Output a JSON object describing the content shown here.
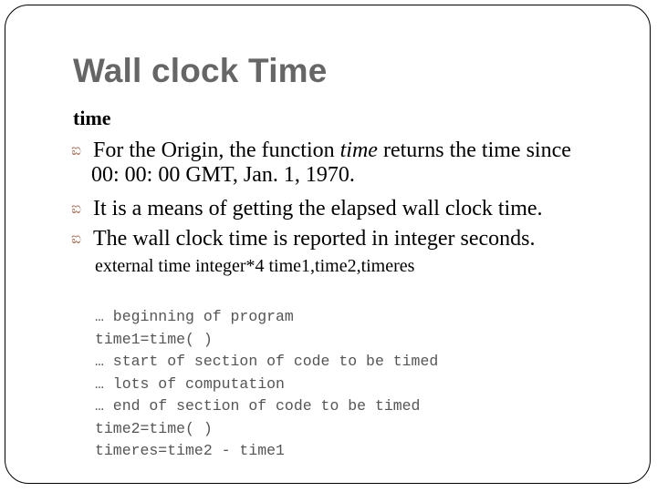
{
  "slide": {
    "title": "Wall clock Time",
    "subheading": "time",
    "bullet_icon": "curl-bullet-icon",
    "bullet_color": "#a5694e",
    "title_color": "#666666",
    "bullets": [
      {
        "before": "For the Origin, the function ",
        "emphasis": "time",
        "after": " returns the time since",
        "continuation": "00: 00: 00 GMT, Jan. 1, 1970."
      },
      {
        "text": "It is a means of getting the elapsed wall clock time."
      },
      {
        "text": "The wall clock time is reported in integer seconds."
      }
    ],
    "declaration": "external time integer*4 time1,time2,timeres",
    "code_lines": [
      "… beginning of program",
      "time1=time( )",
      "… start of section of code to be timed",
      "… lots of computation",
      "… end of section of code to be timed",
      "time2=time( )",
      "timeres=time2 - time1"
    ]
  }
}
